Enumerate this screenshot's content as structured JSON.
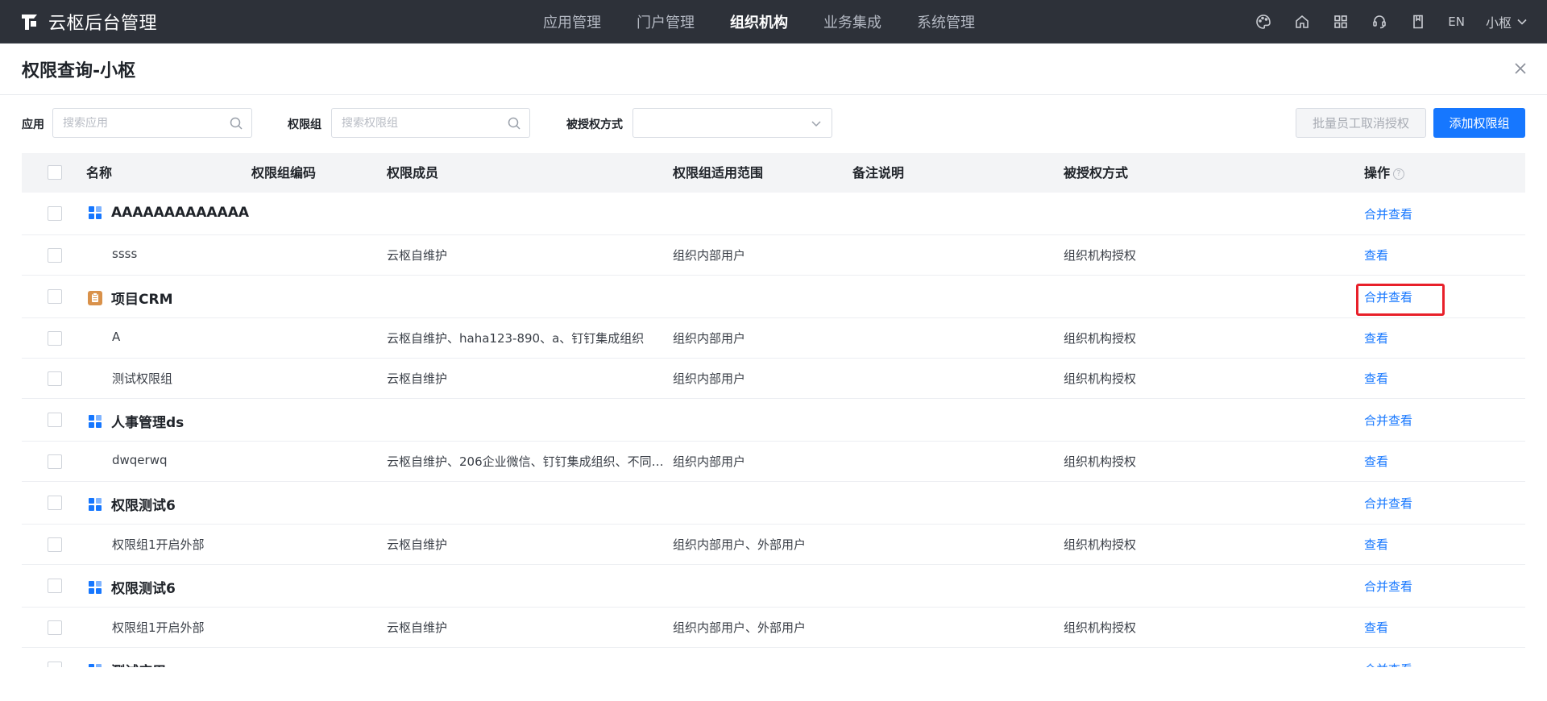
{
  "app": {
    "brand": "云枢后台管理"
  },
  "nav": [
    {
      "label": "应用管理",
      "active": false
    },
    {
      "label": "门户管理",
      "active": false
    },
    {
      "label": "组织机构",
      "active": true
    },
    {
      "label": "业务集成",
      "active": false
    },
    {
      "label": "系统管理",
      "active": false
    }
  ],
  "topRight": {
    "lang": "EN",
    "user": "小枢"
  },
  "panel": {
    "title": "权限查询-小枢"
  },
  "filters": {
    "app_label": "应用",
    "app_placeholder": "搜索应用",
    "group_label": "权限组",
    "group_placeholder": "搜索权限组",
    "auth_label": "被授权方式",
    "auth_value": "",
    "batch_revoke": "批量员工取消授权",
    "add_group": "添加权限组"
  },
  "table": {
    "columns": {
      "name": "名称",
      "code": "权限组编码",
      "members": "权限成员",
      "scope": "权限组适用范围",
      "note": "备注说明",
      "auth": "被授权方式",
      "ops": "操作"
    },
    "help_glyph": "?",
    "rows": [
      {
        "type": "group",
        "name": "AAAAAAAAAAAAA",
        "icon": "grid-app-icon",
        "op": "合并查看"
      },
      {
        "type": "item",
        "name": "ssss",
        "members": "云枢自维护",
        "scope": "组织内部用户",
        "auth": "组织机构授权",
        "op": "查看"
      },
      {
        "type": "group",
        "name": "项目CRM",
        "icon": "clipboard-app-icon",
        "op": "合并查看",
        "highlighted": true
      },
      {
        "type": "item",
        "name": "A",
        "members": "云枢自维护、haha123-890、a、钉钉集成组织",
        "scope": "组织内部用户",
        "auth": "组织机构授权",
        "op": "查看"
      },
      {
        "type": "item",
        "name": "测试权限组",
        "members": "云枢自维护",
        "scope": "组织内部用户",
        "auth": "组织机构授权",
        "op": "查看"
      },
      {
        "type": "group",
        "name": "人事管理ds",
        "icon": "grid-app-icon",
        "op": "合并查看"
      },
      {
        "type": "item",
        "name": "dwqerwq",
        "members": "云枢自维护、206企业微信、钉钉集成组织、不同…",
        "scope": "组织内部用户",
        "auth": "组织机构授权",
        "op": "查看"
      },
      {
        "type": "group",
        "name": "权限测试6",
        "icon": "grid-app-icon",
        "op": "合并查看"
      },
      {
        "type": "item",
        "name": "权限组1开启外部",
        "members": "云枢自维护",
        "scope": "组织内部用户、外部用户",
        "auth": "组织机构授权",
        "op": "查看"
      },
      {
        "type": "group",
        "name": "权限测试6",
        "icon": "grid-app-icon",
        "op": "合并查看"
      },
      {
        "type": "item",
        "name": "权限组1开启外部",
        "members": "云枢自维护",
        "scope": "组织内部用户、外部用户",
        "auth": "组织机构授权",
        "op": "查看"
      },
      {
        "type": "group",
        "name": "测试应用",
        "icon": "grid-app-icon",
        "op": "合并查看"
      }
    ]
  },
  "colors": {
    "accent": "#1677ff",
    "topbar": "#2d3139",
    "highlight": "#e8202a",
    "crm_icon": "#d9914a"
  }
}
